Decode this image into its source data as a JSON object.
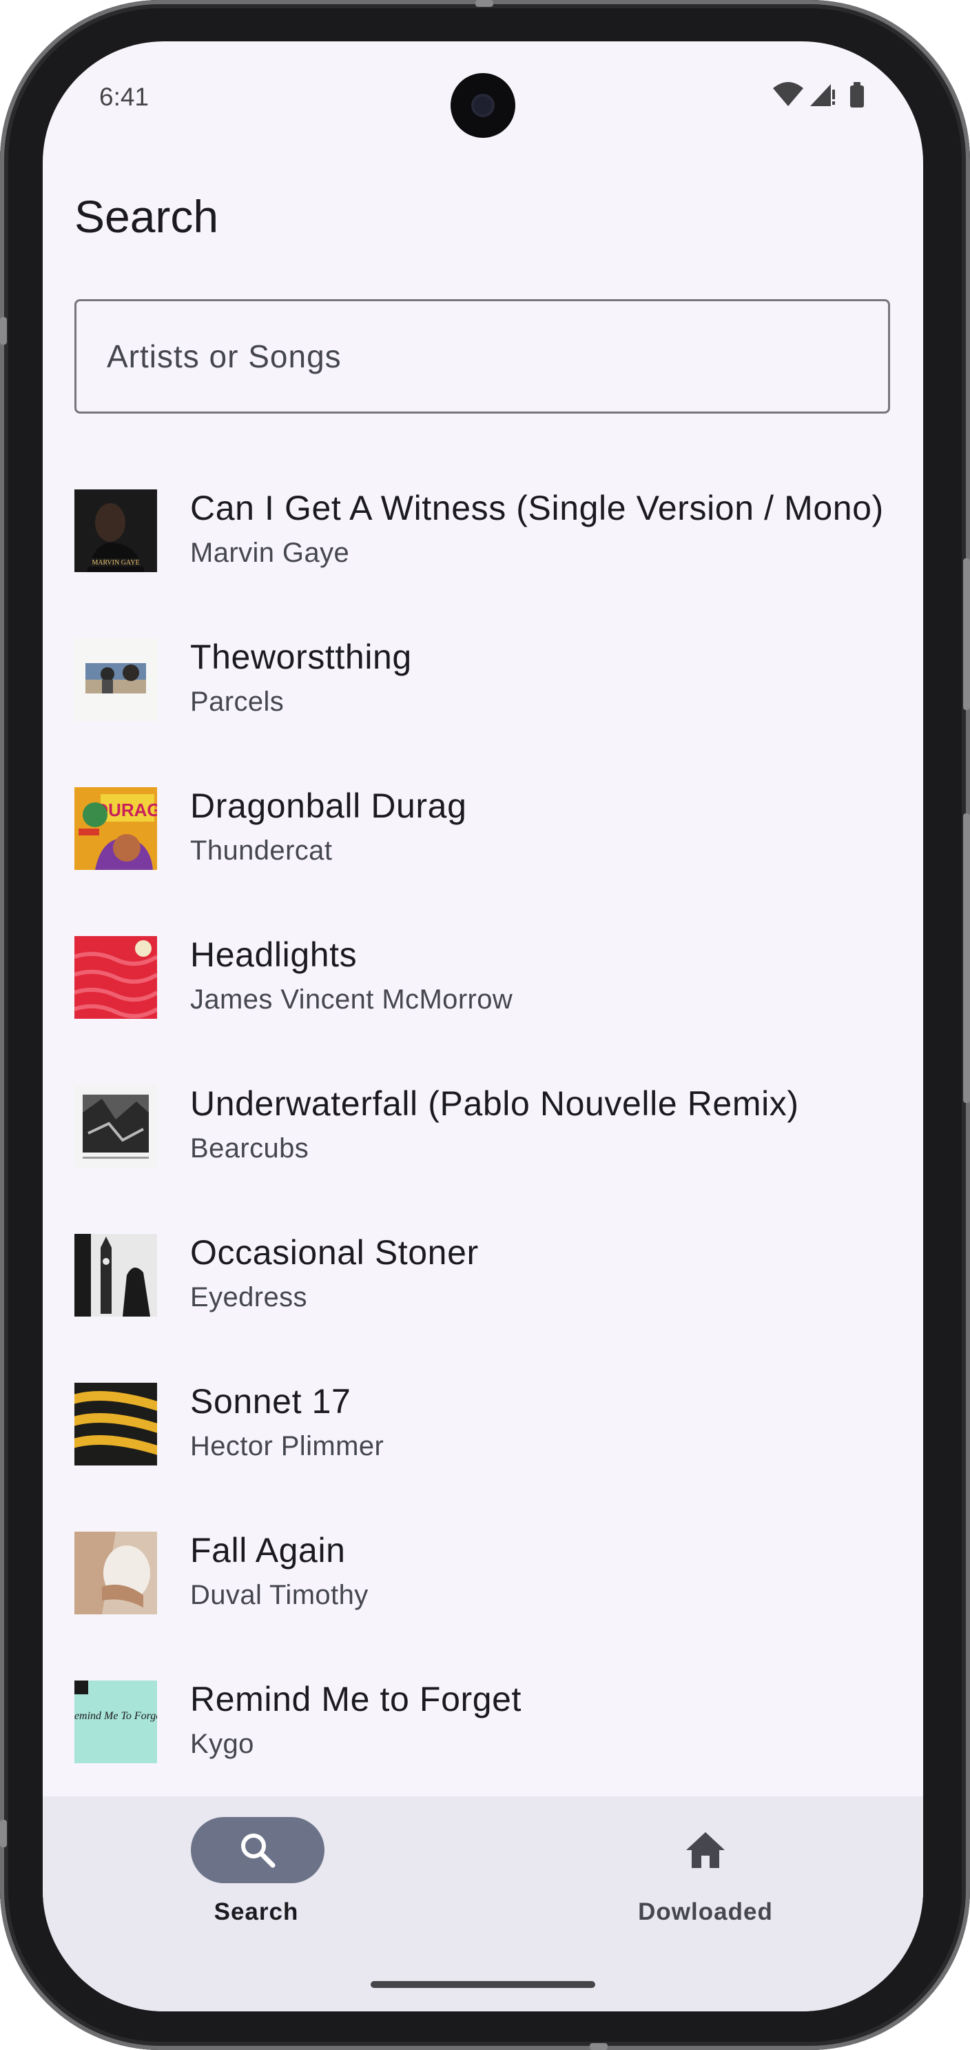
{
  "status_bar": {
    "time": "6:41"
  },
  "header": {
    "title": "Search"
  },
  "search": {
    "placeholder": "Artists or Songs",
    "value": ""
  },
  "songs": [
    {
      "title": "Can I Get A Witness (Single Version / Mono)",
      "artist": "Marvin Gaye",
      "art_text": "MARVIN GAYE"
    },
    {
      "title": "Theworstthing",
      "artist": "Parcels"
    },
    {
      "title": "Dragonball Durag",
      "artist": "Thundercat",
      "art_text": "DURAG"
    },
    {
      "title": "Headlights",
      "artist": "James Vincent McMorrow"
    },
    {
      "title": "Underwaterfall (Pablo Nouvelle Remix)",
      "artist": "Bearcubs"
    },
    {
      "title": "Occasional Stoner",
      "artist": "Eyedress"
    },
    {
      "title": "Sonnet 17",
      "artist": "Hector Plimmer"
    },
    {
      "title": "Fall Again",
      "artist": "Duval Timothy"
    },
    {
      "title": "Remind Me to Forget",
      "artist": "Kygo",
      "art_text": "Remind Me To Forget"
    },
    {
      "title": "",
      "artist": ""
    }
  ],
  "bottom_nav": {
    "items": [
      {
        "label": "Search",
        "icon": "search-icon",
        "active": true
      },
      {
        "label": "Dowloaded",
        "icon": "home-icon",
        "active": false
      }
    ]
  },
  "colors": {
    "active_indicator": "#6c7389",
    "nav_background": "#e9e7f0",
    "screen_background": "#f7f5fb"
  }
}
